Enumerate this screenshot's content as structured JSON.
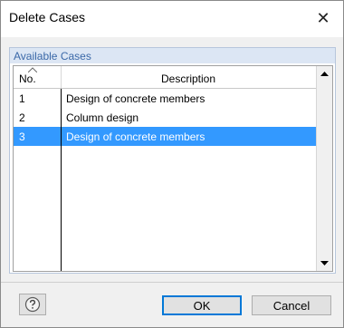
{
  "window": {
    "title": "Delete Cases",
    "close_glyph": "✕"
  },
  "group": {
    "title": "Available Cases"
  },
  "table": {
    "columns": [
      "No.",
      "Description"
    ],
    "rows": [
      {
        "no": "1",
        "description": "Design of concrete members",
        "selected": false
      },
      {
        "no": "2",
        "description": "Column design",
        "selected": false
      },
      {
        "no": "3",
        "description": "Design of concrete members",
        "selected": true
      }
    ]
  },
  "buttons": {
    "ok": "OK",
    "cancel": "Cancel"
  },
  "icons": {
    "help": "help-icon",
    "sort": "sort-ascending-icon",
    "scroll_up": "scroll-up-arrow-icon",
    "scroll_down": "scroll-down-arrow-icon"
  },
  "colors": {
    "selection": "#3399ff",
    "group_header": "#dce6f4",
    "group_title": "#3a68a8"
  }
}
